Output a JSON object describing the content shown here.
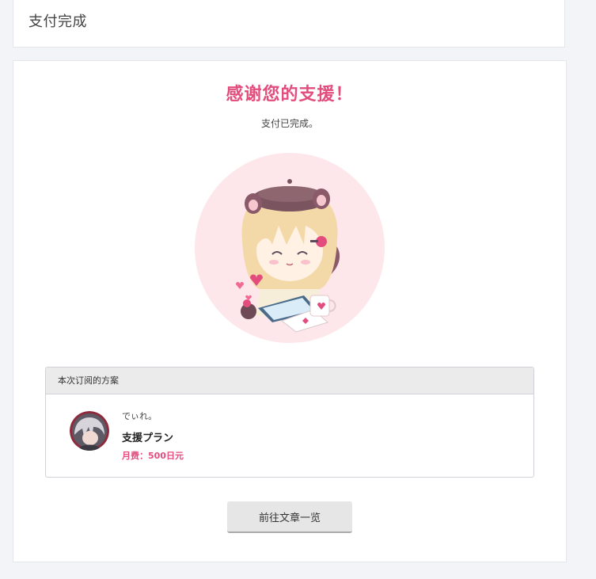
{
  "header": {
    "title": "支付完成"
  },
  "main": {
    "thanks_title": "感谢您的支援！",
    "thanks_subtitle": "支付已完成。"
  },
  "plan": {
    "section_label": "本次订阅的方案",
    "creator_name": "でぃれ。",
    "plan_name": "支援プラン",
    "price": "月费：500日元"
  },
  "actions": {
    "back_label": "前往文章一览"
  },
  "colors": {
    "accent": "#e34d7e",
    "page_background": "#f2f4f7",
    "illustration_background": "#fde7ea"
  },
  "icons": {
    "illustration": "mascot-illustration",
    "avatar": "creator-avatar"
  }
}
